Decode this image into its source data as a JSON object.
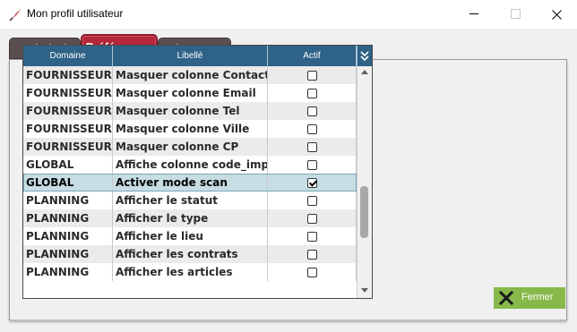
{
  "window": {
    "title": "Mon profil utilisateur",
    "icon": "feather-quill-icon"
  },
  "tabs": [
    {
      "label": "Général",
      "active": false
    },
    {
      "label": "Préférences",
      "active": true
    },
    {
      "label": "Signature",
      "active": false
    }
  ],
  "table": {
    "headers": {
      "domain": "Domaine",
      "libelle": "Libellé",
      "actif": "Actif"
    },
    "rows": [
      {
        "domain": "FOURNISSEUR",
        "libelle": "Masquer colonne Contact",
        "actif": false
      },
      {
        "domain": "FOURNISSEUR",
        "libelle": "Masquer colonne Email",
        "actif": false
      },
      {
        "domain": "FOURNISSEUR",
        "libelle": "Masquer colonne Tel",
        "actif": false
      },
      {
        "domain": "FOURNISSEUR",
        "libelle": "Masquer colonne Ville",
        "actif": false
      },
      {
        "domain": "FOURNISSEUR",
        "libelle": "Masquer colonne CP",
        "actif": false
      },
      {
        "domain": "GLOBAL",
        "libelle": "Affiche colonne code_import",
        "actif": false
      },
      {
        "domain": "GLOBAL",
        "libelle": "Activer mode scan",
        "actif": true,
        "selected": true
      },
      {
        "domain": "PLANNING",
        "libelle": "Afficher le statut",
        "actif": false
      },
      {
        "domain": "PLANNING",
        "libelle": "Afficher le type",
        "actif": false
      },
      {
        "domain": "PLANNING",
        "libelle": "Afficher le lieu",
        "actif": false
      },
      {
        "domain": "PLANNING",
        "libelle": "Afficher les contrats",
        "actif": false
      },
      {
        "domain": "PLANNING",
        "libelle": "Afficher les articles",
        "actif": false
      }
    ]
  },
  "buttons": {
    "fermer": "Fermer"
  },
  "colors": {
    "header_bg": "#2e6286",
    "tab_active": "#b5263a",
    "tab_inactive": "#5a4f4f",
    "button_green": "#87b84a",
    "row_selected": "#c6dde3"
  }
}
